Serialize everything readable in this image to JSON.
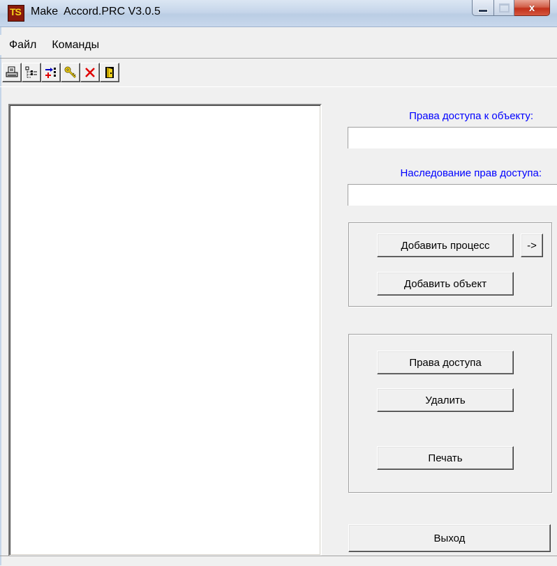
{
  "window": {
    "title": "Make  Accord.PRC V3.0.5",
    "icon_text": "TS",
    "controls": {
      "close_glyph": "x"
    }
  },
  "menu": [
    "Файл",
    "Команды"
  ],
  "toolbar": {
    "buttons": [
      "print-icon",
      "tree-icon",
      "add-icon",
      "key-icon",
      "delete-icon",
      "exit-door-icon"
    ]
  },
  "right_panel": {
    "access_rights_label": "Права доступа к объекту:",
    "access_rights_value": "",
    "inheritance_label": "Наследование прав доступа:",
    "inheritance_value": "",
    "add_process_label": "Добавить процесс",
    "arrow_label": "->",
    "add_object_label": "Добавить объект",
    "rights_label": "Права доступа",
    "delete_label": "Удалить",
    "print_label": "Печать",
    "exit_label": "Выход"
  },
  "colors": {
    "label_blue": "#0000ff",
    "window_bg": "#f0f0f0"
  }
}
